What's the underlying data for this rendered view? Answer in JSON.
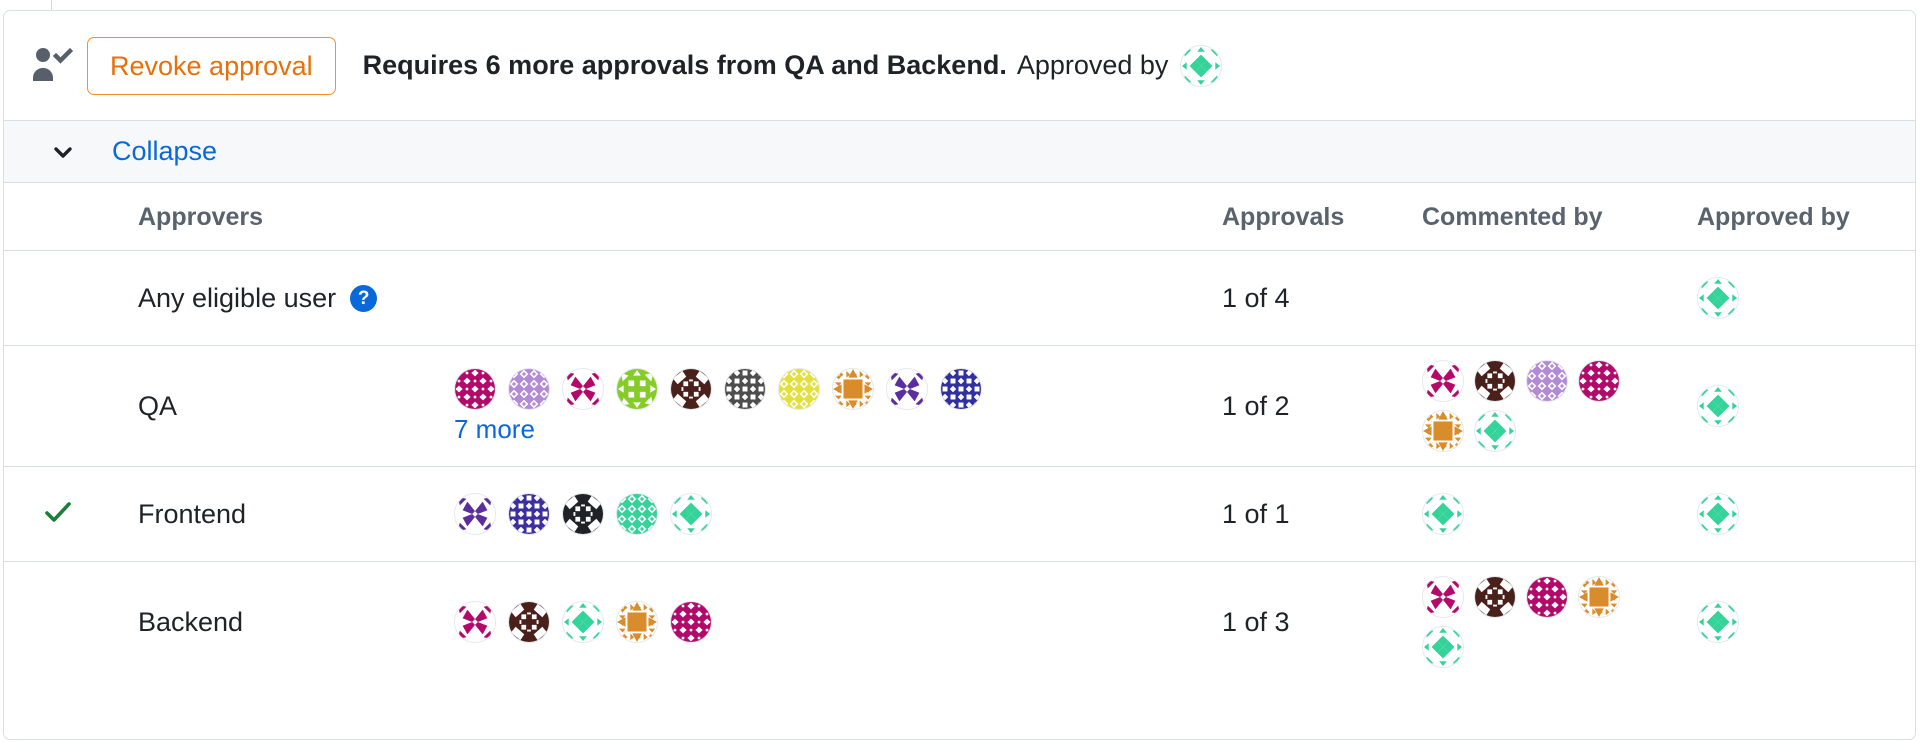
{
  "header": {
    "icon": "person-check-icon",
    "revoke_label": "Revoke approval",
    "status_bold": "Requires 6 more approvals from QA and Backend.",
    "approved_by_label": "Approved by",
    "approved_by_avatar": {
      "seed": 7,
      "color": "#34d399",
      "pattern": "diamond"
    }
  },
  "collapse": {
    "icon": "chevron-down-icon",
    "label": "Collapse"
  },
  "table": {
    "columns": [
      "Approvers",
      "Approvals",
      "Commented by",
      "Approved by"
    ],
    "rows": [
      {
        "status": "",
        "name": "Any eligible user",
        "help_icon": "?",
        "approvers": [],
        "more": "",
        "approvals": "1 of 4",
        "commented_by": [],
        "approved_by": [
          {
            "seed": 7,
            "color": "#34d399",
            "pattern": "diamond"
          }
        ]
      },
      {
        "status": "",
        "name": "QA",
        "help_icon": "",
        "approvers": [
          {
            "seed": 1,
            "color": "#b3096b",
            "pattern": "dots"
          },
          {
            "seed": 2,
            "color": "#b38ad6",
            "pattern": "rings"
          },
          {
            "seed": 3,
            "color": "#b3096b",
            "pattern": "pinwheel"
          },
          {
            "seed": 4,
            "color": "#86cc28",
            "pattern": "grid"
          },
          {
            "seed": 5,
            "color": "#4a211a",
            "pattern": "weave"
          },
          {
            "seed": 6,
            "color": "#4d4d4d",
            "pattern": "lattice"
          },
          {
            "seed": 8,
            "color": "#e3e03c",
            "pattern": "rings"
          },
          {
            "seed": 9,
            "color": "#d98c2b",
            "pattern": "burst"
          },
          {
            "seed": 10,
            "color": "#5b2d9e",
            "pattern": "pinwheel"
          },
          {
            "seed": 11,
            "color": "#2f2f9e",
            "pattern": "lattice"
          }
        ],
        "more": "7 more",
        "approvals": "1 of 2",
        "commented_by": [
          {
            "seed": 3,
            "color": "#b3096b",
            "pattern": "pinwheel"
          },
          {
            "seed": 5,
            "color": "#4a211a",
            "pattern": "weave"
          },
          {
            "seed": 2,
            "color": "#b38ad6",
            "pattern": "rings"
          },
          {
            "seed": 1,
            "color": "#b3096b",
            "pattern": "dots"
          },
          {
            "seed": 9,
            "color": "#d98c2b",
            "pattern": "burst"
          },
          {
            "seed": 7,
            "color": "#34d399",
            "pattern": "diamond"
          }
        ],
        "approved_by": [
          {
            "seed": 7,
            "color": "#34d399",
            "pattern": "diamond"
          }
        ]
      },
      {
        "status": "check-icon",
        "name": "Frontend",
        "help_icon": "",
        "approvers": [
          {
            "seed": 10,
            "color": "#5b2d9e",
            "pattern": "pinwheel"
          },
          {
            "seed": 11,
            "color": "#3b2f9e",
            "pattern": "lattice"
          },
          {
            "seed": 12,
            "color": "#1f2328",
            "pattern": "weave"
          },
          {
            "seed": 13,
            "color": "#34d399",
            "pattern": "rings"
          },
          {
            "seed": 7,
            "color": "#34d399",
            "pattern": "diamond"
          }
        ],
        "more": "",
        "approvals": "1 of 1",
        "commented_by": [
          {
            "seed": 7,
            "color": "#34d399",
            "pattern": "diamond"
          }
        ],
        "approved_by": [
          {
            "seed": 7,
            "color": "#34d399",
            "pattern": "diamond"
          }
        ]
      },
      {
        "status": "",
        "name": "Backend",
        "help_icon": "",
        "approvers": [
          {
            "seed": 3,
            "color": "#b3096b",
            "pattern": "pinwheel"
          },
          {
            "seed": 5,
            "color": "#4a211a",
            "pattern": "weave"
          },
          {
            "seed": 7,
            "color": "#34d399",
            "pattern": "diamond"
          },
          {
            "seed": 9,
            "color": "#d98c2b",
            "pattern": "burst"
          },
          {
            "seed": 1,
            "color": "#b3096b",
            "pattern": "dots"
          }
        ],
        "more": "",
        "approvals": "1 of 3",
        "commented_by": [
          {
            "seed": 3,
            "color": "#b3096b",
            "pattern": "pinwheel"
          },
          {
            "seed": 5,
            "color": "#4a211a",
            "pattern": "weave"
          },
          {
            "seed": 1,
            "color": "#b3096b",
            "pattern": "dots"
          },
          {
            "seed": 9,
            "color": "#d98c2b",
            "pattern": "burst"
          },
          {
            "seed": 7,
            "color": "#34d399",
            "pattern": "diamond"
          }
        ],
        "approved_by": [
          {
            "seed": 7,
            "color": "#34d399",
            "pattern": "diamond"
          }
        ]
      }
    ]
  },
  "colors": {
    "link": "#0969da",
    "accent_orange": "#e8700a",
    "check_green": "#1a7f37",
    "border": "#d8dee4",
    "header_bg": "#f6f8fa",
    "text": "#1f2328",
    "muted": "#59636e"
  }
}
